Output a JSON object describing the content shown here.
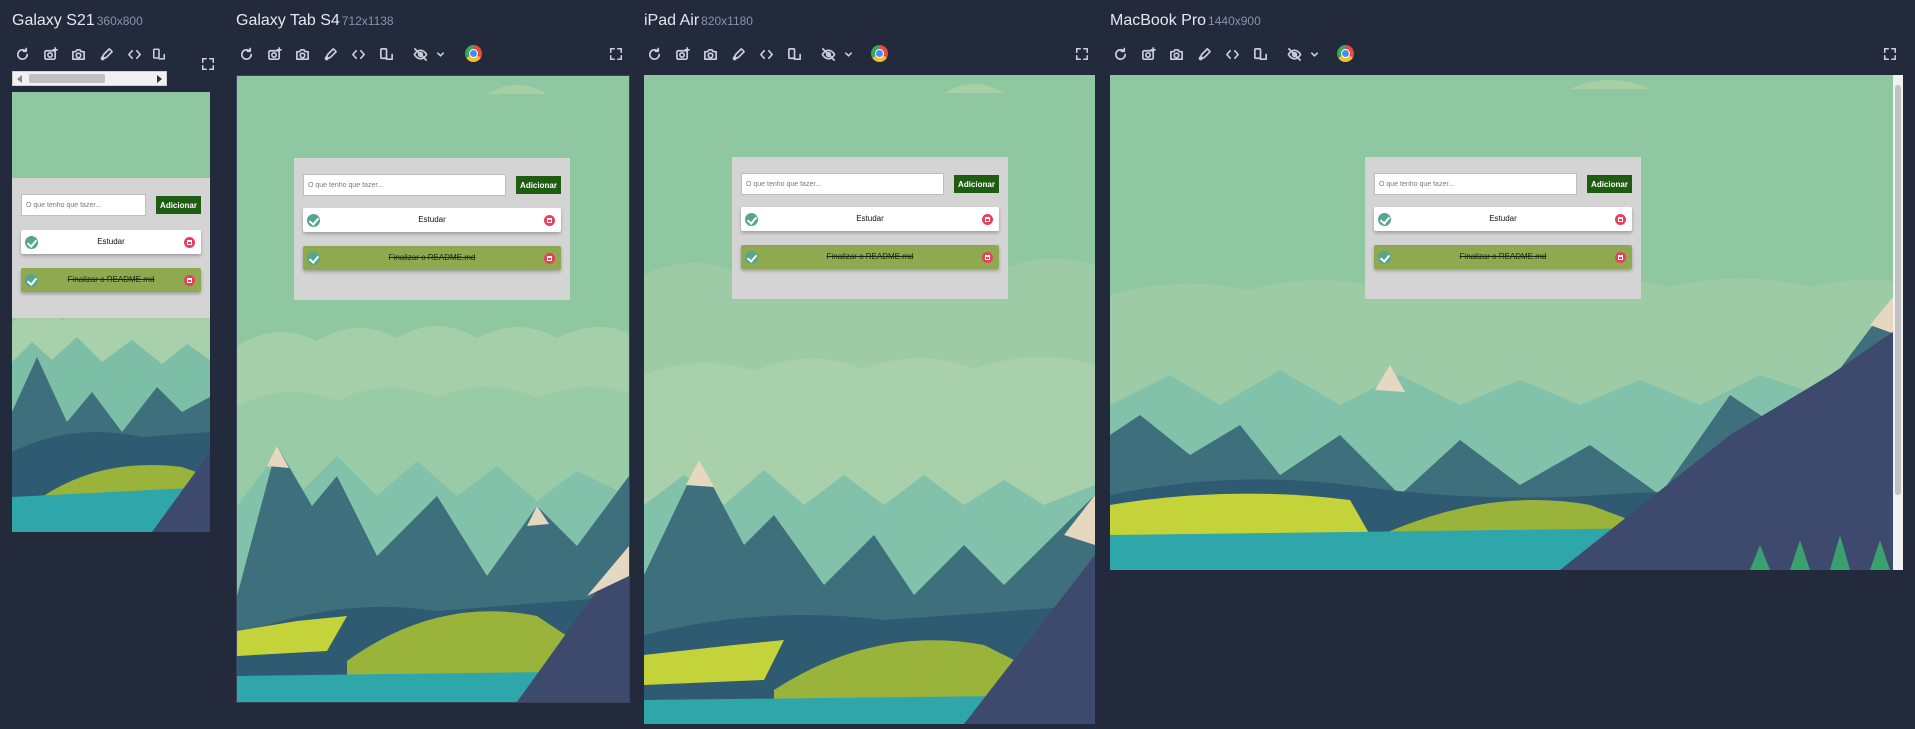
{
  "devices": [
    {
      "name": "Galaxy S21",
      "size": "360x800"
    },
    {
      "name": "Galaxy Tab S4",
      "size": "712x1138"
    },
    {
      "name": "iPad Air",
      "size": "820x1180"
    },
    {
      "name": "MacBook Pro",
      "size": "1440x900"
    }
  ],
  "toolbar_icons": [
    "refresh-icon",
    "screenshot-capture-icon",
    "camera-icon",
    "design-mode-icon",
    "code-icon",
    "rotate-device-icon",
    "eye-slash-icon",
    "chevron-down-icon",
    "chrome-icon"
  ],
  "app": {
    "input_placeholder": "O que tenho que fazer...",
    "add_label": "Adicionar",
    "tasks": [
      {
        "text": "Estudar",
        "done": false
      },
      {
        "text": "Finalizar o README.md",
        "done": true
      }
    ]
  },
  "colors": {
    "background": "#222a3b",
    "sky": "#8fc7a1",
    "add_button": "#1e5c12",
    "done_task": "#8ea950",
    "check": "#56a58f",
    "delete": "#e7405c",
    "panel": "#d4d4d4"
  }
}
